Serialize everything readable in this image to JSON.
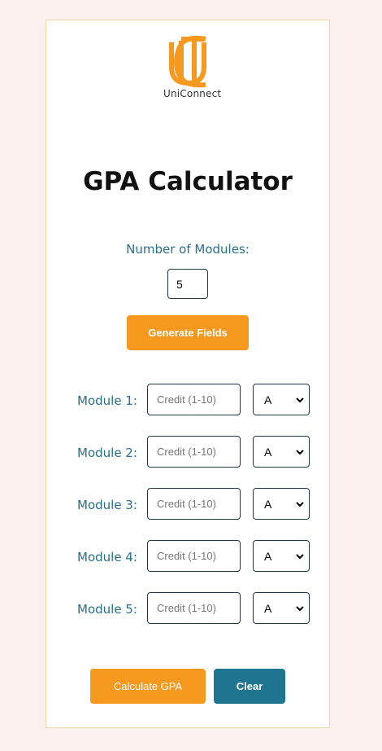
{
  "brand": {
    "name": "UniConnect",
    "accent": "#f7981f",
    "secondary": "#1f7590"
  },
  "page": {
    "title": "GPA Calculator"
  },
  "module_count": {
    "label": "Number of Modules:",
    "value": "5"
  },
  "buttons": {
    "generate": "Generate Fields",
    "calculate": "Calculate GPA",
    "clear": "Clear"
  },
  "modules": [
    {
      "label": "Module 1:",
      "credit_placeholder": "Credit (1-10)",
      "grade": "A"
    },
    {
      "label": "Module 2:",
      "credit_placeholder": "Credit (1-10)",
      "grade": "A"
    },
    {
      "label": "Module 3:",
      "credit_placeholder": "Credit (1-10)",
      "grade": "A"
    },
    {
      "label": "Module 4:",
      "credit_placeholder": "Credit (1-10)",
      "grade": "A"
    },
    {
      "label": "Module 5:",
      "credit_placeholder": "Credit (1-10)",
      "grade": "A"
    }
  ]
}
